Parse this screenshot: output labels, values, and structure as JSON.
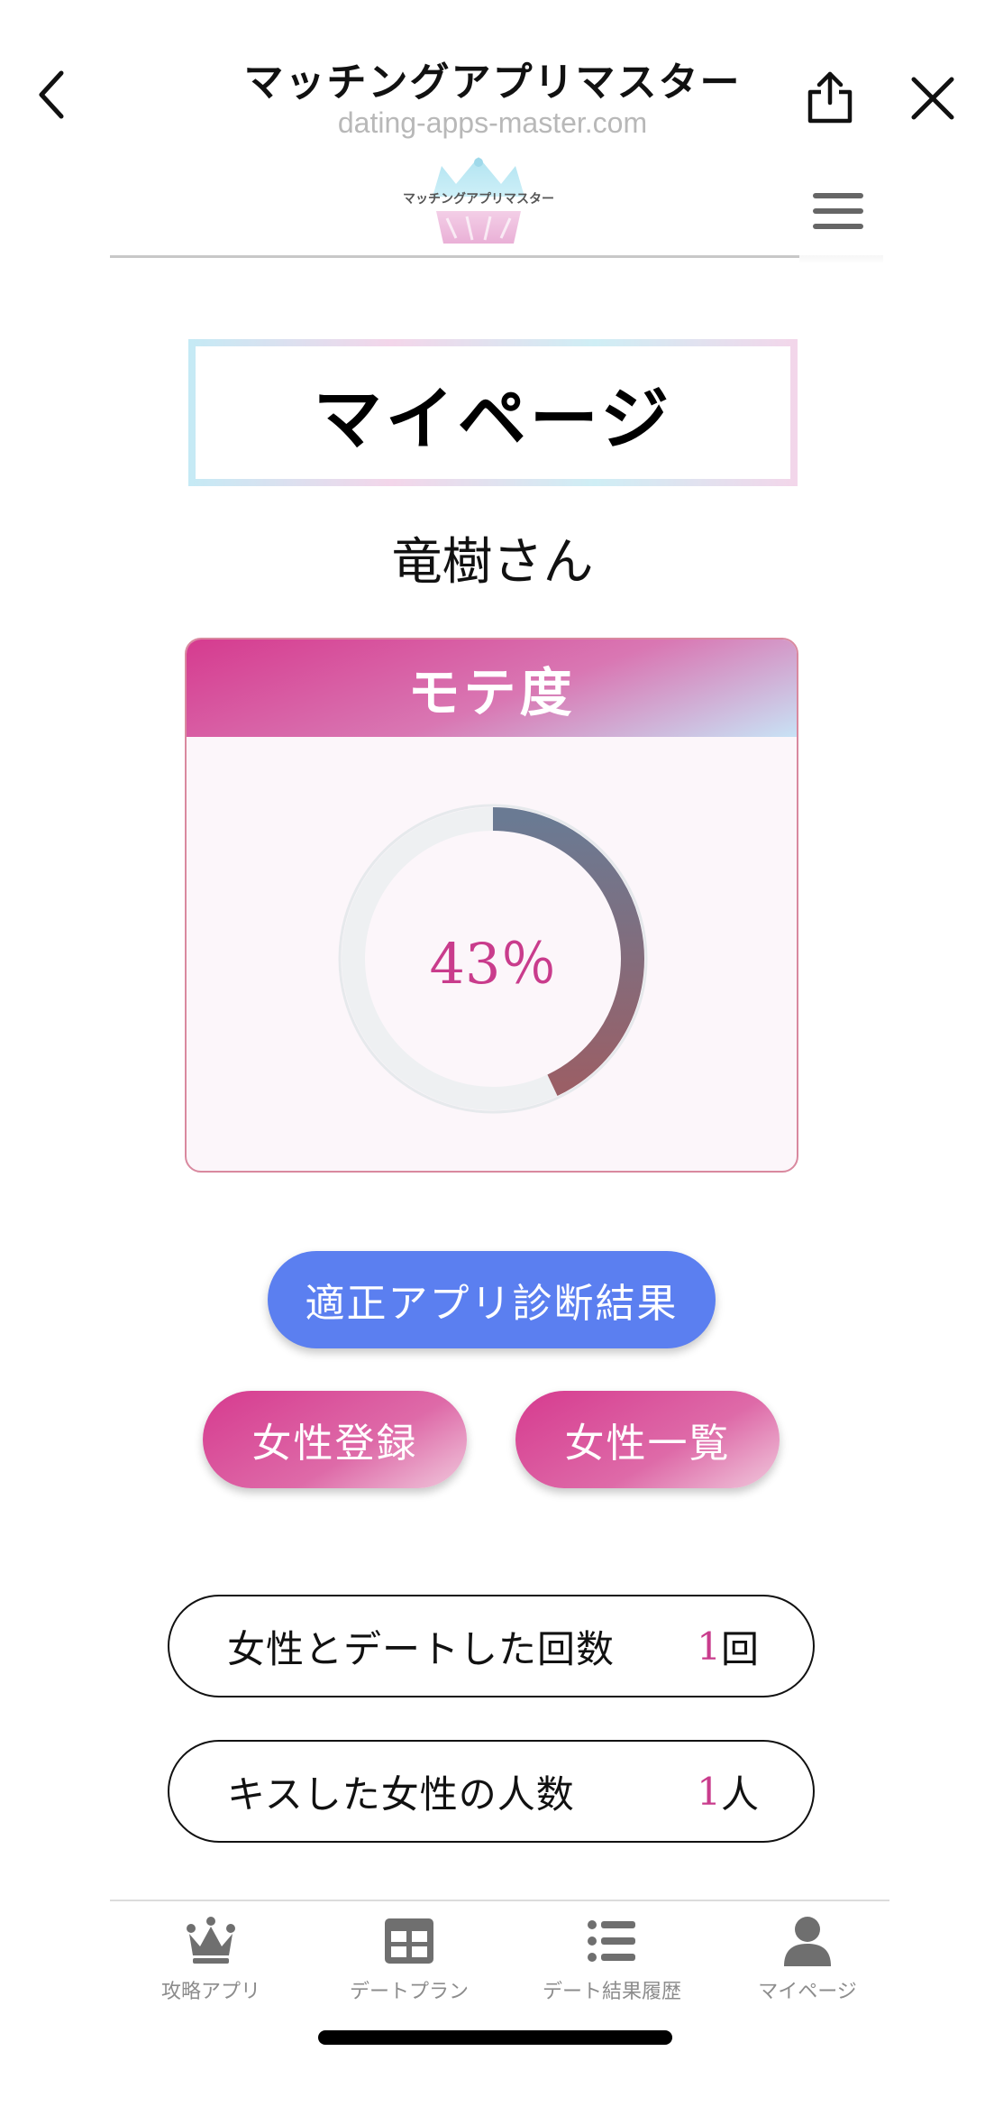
{
  "browser": {
    "title": "マッチングアプリマスター",
    "url": "dating-apps-master.com",
    "icons": {
      "back": "chevron-left-icon",
      "share": "share-icon",
      "close": "close-icon"
    }
  },
  "site": {
    "logo_text": "マッチングアプリマスター",
    "menu_icon": "hamburger-menu-icon"
  },
  "page": {
    "title": "マイページ",
    "user_name": "竜樹さん"
  },
  "mote_card": {
    "title": "モテ度",
    "value_label": "43％",
    "percent": 43
  },
  "buttons": {
    "diagnosis": "適正アプリ診断結果",
    "register_female": "女性登録",
    "female_list": "女性一覧"
  },
  "stats": [
    {
      "label": "女性とデートした回数",
      "value": "1",
      "unit": "回"
    },
    {
      "label": "キスした女性の人数",
      "value": "1",
      "unit": "人"
    }
  ],
  "bottom_nav": [
    {
      "label": "攻略アプリ",
      "icon": "crown-icon"
    },
    {
      "label": "デートプラン",
      "icon": "grid-icon"
    },
    {
      "label": "デート結果履歴",
      "icon": "list-icon"
    },
    {
      "label": "マイページ",
      "icon": "user-icon"
    }
  ],
  "colors": {
    "accent_pink": "#c93c8c",
    "button_blue": "#5b7ff0",
    "gauge_start": "#6a7a93",
    "gauge_end": "#9a5f66",
    "gauge_track": "#eef0f2"
  }
}
